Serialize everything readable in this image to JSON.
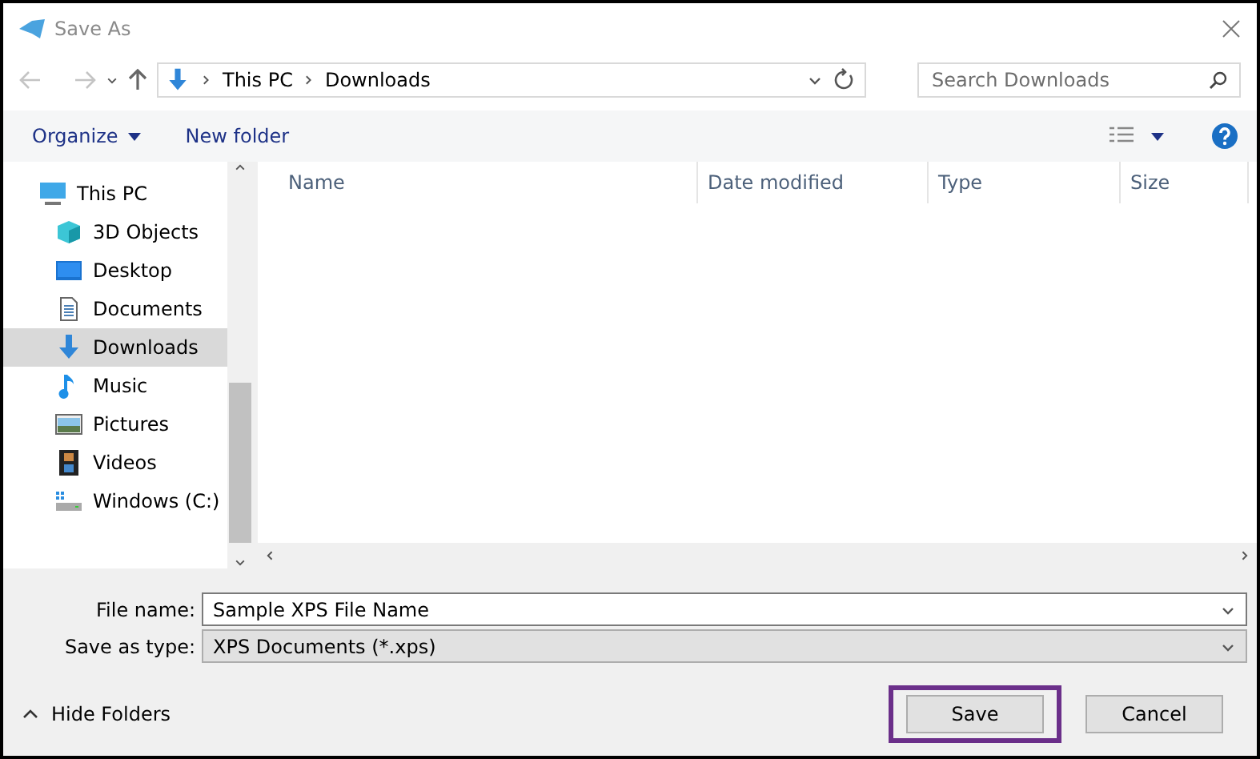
{
  "window": {
    "title": "Save As"
  },
  "breadcrumb": [
    "This PC",
    "Downloads"
  ],
  "search": {
    "placeholder": "Search Downloads"
  },
  "toolbar": {
    "organize": "Organize",
    "new_folder": "New folder"
  },
  "sidebar": {
    "items": [
      {
        "label": "This PC",
        "kind": "pc",
        "selected": false,
        "children": [
          {
            "label": "3D Objects",
            "kind": "cube",
            "selected": false
          },
          {
            "label": "Desktop",
            "kind": "desktop",
            "selected": false
          },
          {
            "label": "Documents",
            "kind": "document",
            "selected": false
          },
          {
            "label": "Downloads",
            "kind": "download",
            "selected": true
          },
          {
            "label": "Music",
            "kind": "music",
            "selected": false
          },
          {
            "label": "Pictures",
            "kind": "pictures",
            "selected": false
          },
          {
            "label": "Videos",
            "kind": "videos",
            "selected": false
          },
          {
            "label": "Windows (C:)",
            "kind": "drive",
            "selected": false
          }
        ]
      }
    ]
  },
  "table": {
    "columns": [
      "Name",
      "Date modified",
      "Type",
      "Size"
    ]
  },
  "form": {
    "file_name_label": "File name:",
    "file_name": "Sample XPS File Name",
    "type_label": "Save as type:",
    "type": "XPS Documents (*.xps)"
  },
  "hide_folders": "Hide Folders",
  "buttons": [
    {
      "label": "Save",
      "highlighted": true
    },
    {
      "label": "Cancel",
      "highlighted": false
    }
  ]
}
